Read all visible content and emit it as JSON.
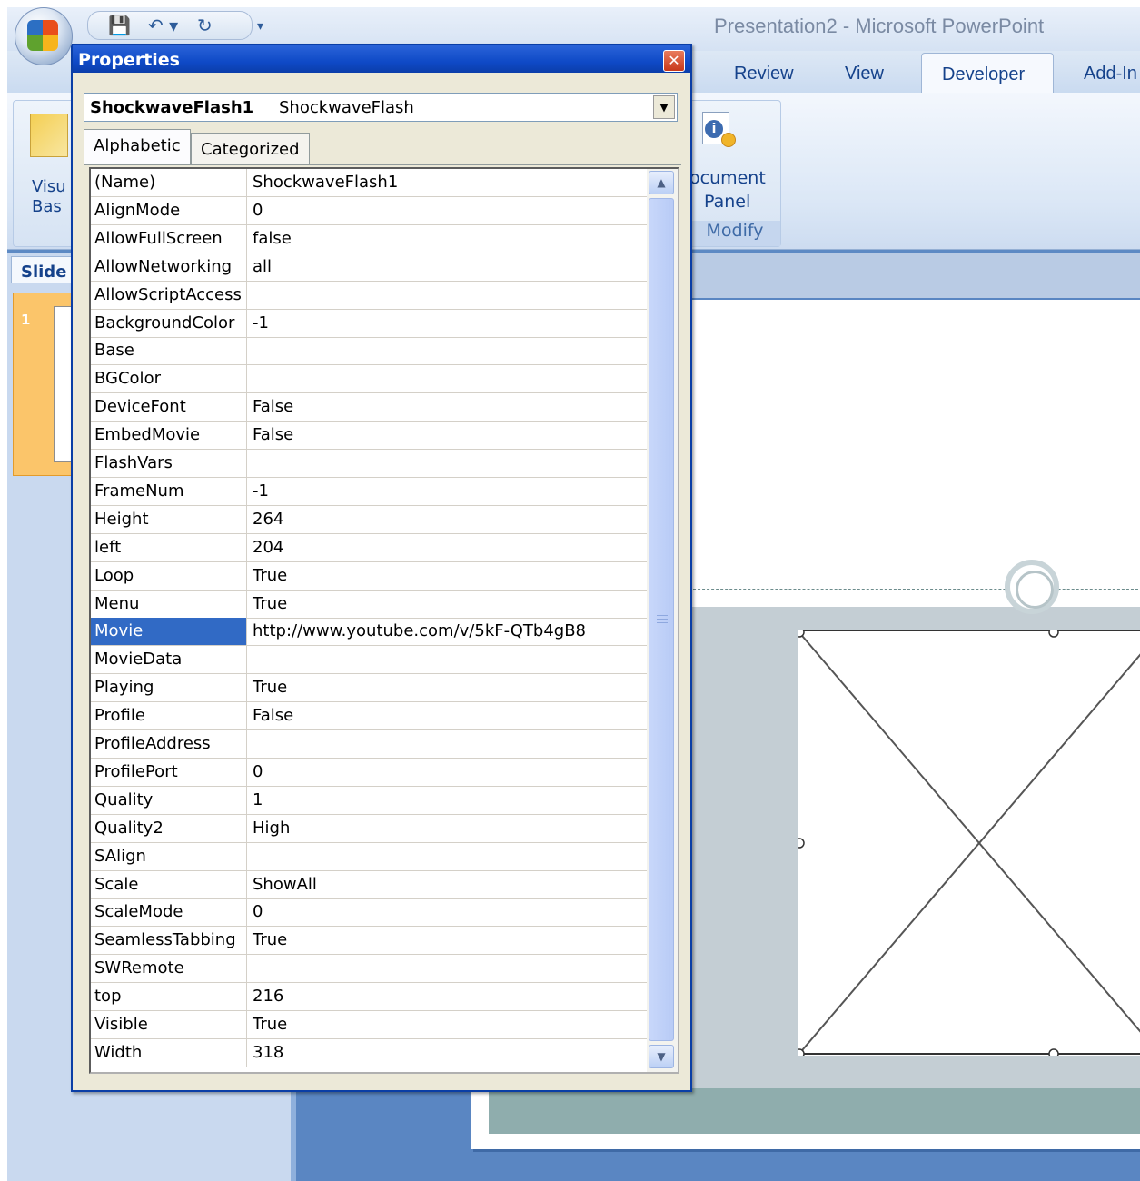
{
  "window": {
    "title": "Presentation2 - Microsoft PowerPoint"
  },
  "quick_access": {
    "save": "💾",
    "undo": "↶ ▾",
    "redo": "↻",
    "more": "▾"
  },
  "ribbon": {
    "tabs": [
      "Review",
      "View",
      "Developer",
      "Add-In"
    ],
    "active_tab": "Developer",
    "left_group": {
      "label_line1": "Visu",
      "label_line2": "Bas"
    },
    "modify_group": {
      "button_line1": "ocument",
      "button_line2": "Panel",
      "group_name": "Modify"
    }
  },
  "slides_pane": {
    "tab_label": "Slide",
    "thumbnail_number": "1"
  },
  "properties": {
    "title": "Properties",
    "close_glyph": "✕",
    "object_name": "ShockwaveFlash1",
    "object_type": "ShockwaveFlash",
    "tabs": [
      "Alphabetic",
      "Categorized"
    ],
    "active_tab": "Alphabetic",
    "selected_property": "Movie",
    "rows": [
      {
        "name": "(Name)",
        "value": "ShockwaveFlash1"
      },
      {
        "name": "AlignMode",
        "value": "0"
      },
      {
        "name": "AllowFullScreen",
        "value": "false"
      },
      {
        "name": "AllowNetworking",
        "value": "all"
      },
      {
        "name": "AllowScriptAccess",
        "value": ""
      },
      {
        "name": "BackgroundColor",
        "value": "-1"
      },
      {
        "name": "Base",
        "value": ""
      },
      {
        "name": "BGColor",
        "value": ""
      },
      {
        "name": "DeviceFont",
        "value": "False"
      },
      {
        "name": "EmbedMovie",
        "value": "False"
      },
      {
        "name": "FlashVars",
        "value": ""
      },
      {
        "name": "FrameNum",
        "value": "-1"
      },
      {
        "name": "Height",
        "value": "264"
      },
      {
        "name": "left",
        "value": "204"
      },
      {
        "name": "Loop",
        "value": "True"
      },
      {
        "name": "Menu",
        "value": "True"
      },
      {
        "name": "Movie",
        "value": "http://www.youtube.com/v/5kF-QTb4gB8"
      },
      {
        "name": "MovieData",
        "value": ""
      },
      {
        "name": "Playing",
        "value": "True"
      },
      {
        "name": "Profile",
        "value": "False"
      },
      {
        "name": "ProfileAddress",
        "value": ""
      },
      {
        "name": "ProfilePort",
        "value": "0"
      },
      {
        "name": "Quality",
        "value": "1"
      },
      {
        "name": "Quality2",
        "value": "High"
      },
      {
        "name": "SAlign",
        "value": ""
      },
      {
        "name": "Scale",
        "value": "ShowAll"
      },
      {
        "name": "ScaleMode",
        "value": "0"
      },
      {
        "name": "SeamlessTabbing",
        "value": "True"
      },
      {
        "name": "SWRemote",
        "value": ""
      },
      {
        "name": "top",
        "value": "216"
      },
      {
        "name": "Visible",
        "value": "True"
      },
      {
        "name": "Width",
        "value": "318"
      }
    ]
  },
  "colors": {
    "selection": "#316ac5",
    "dialog_title": "#0f4ac7",
    "workspace": "#5d8ac4"
  }
}
